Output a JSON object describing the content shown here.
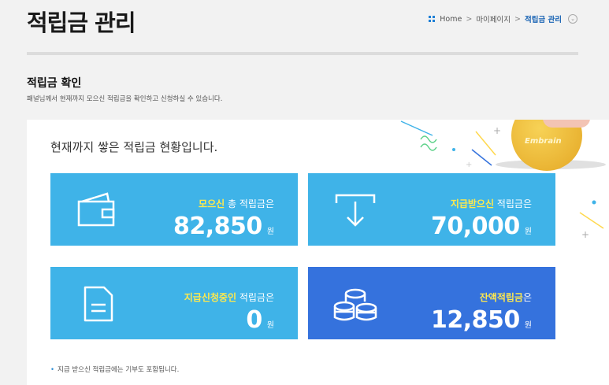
{
  "page": {
    "title": "적립금 관리",
    "breadcrumb": {
      "home": "Home",
      "sep": ">",
      "parent": "마이페이지",
      "current": "적립금 관리"
    }
  },
  "section": {
    "title": "적립금 확인",
    "description": "패널님께서 현재까지 모으신 적립금을 확인하고 신청하실 수 있습니다."
  },
  "panel": {
    "heading": "현재까지 쌓은 적립금 현황입니다.",
    "coin_text": "Embrain",
    "cards": [
      {
        "highlight": "모으신",
        "suffix": " 총 적립금은",
        "amount": "82,850",
        "unit": "원",
        "icon": "wallet-icon"
      },
      {
        "highlight": "지급받으신",
        "suffix": " 적립금은",
        "amount": "70,000",
        "unit": "원",
        "icon": "download-arrow-icon"
      },
      {
        "highlight": "지급신청중인",
        "suffix": " 적립금은",
        "amount": "0",
        "unit": "원",
        "icon": "document-icon"
      },
      {
        "highlight": "잔액적립금",
        "suffix": "은",
        "amount": "12,850",
        "unit": "원",
        "icon": "coins-icon"
      }
    ],
    "note": "지급 받으신 적립금에는 기부도 포함됩니다."
  },
  "colors": {
    "card_light": "#3fb3e8",
    "card_dark": "#3572dd",
    "highlight": "#ffe94d",
    "breadcrumb_current": "#1a64b4"
  }
}
